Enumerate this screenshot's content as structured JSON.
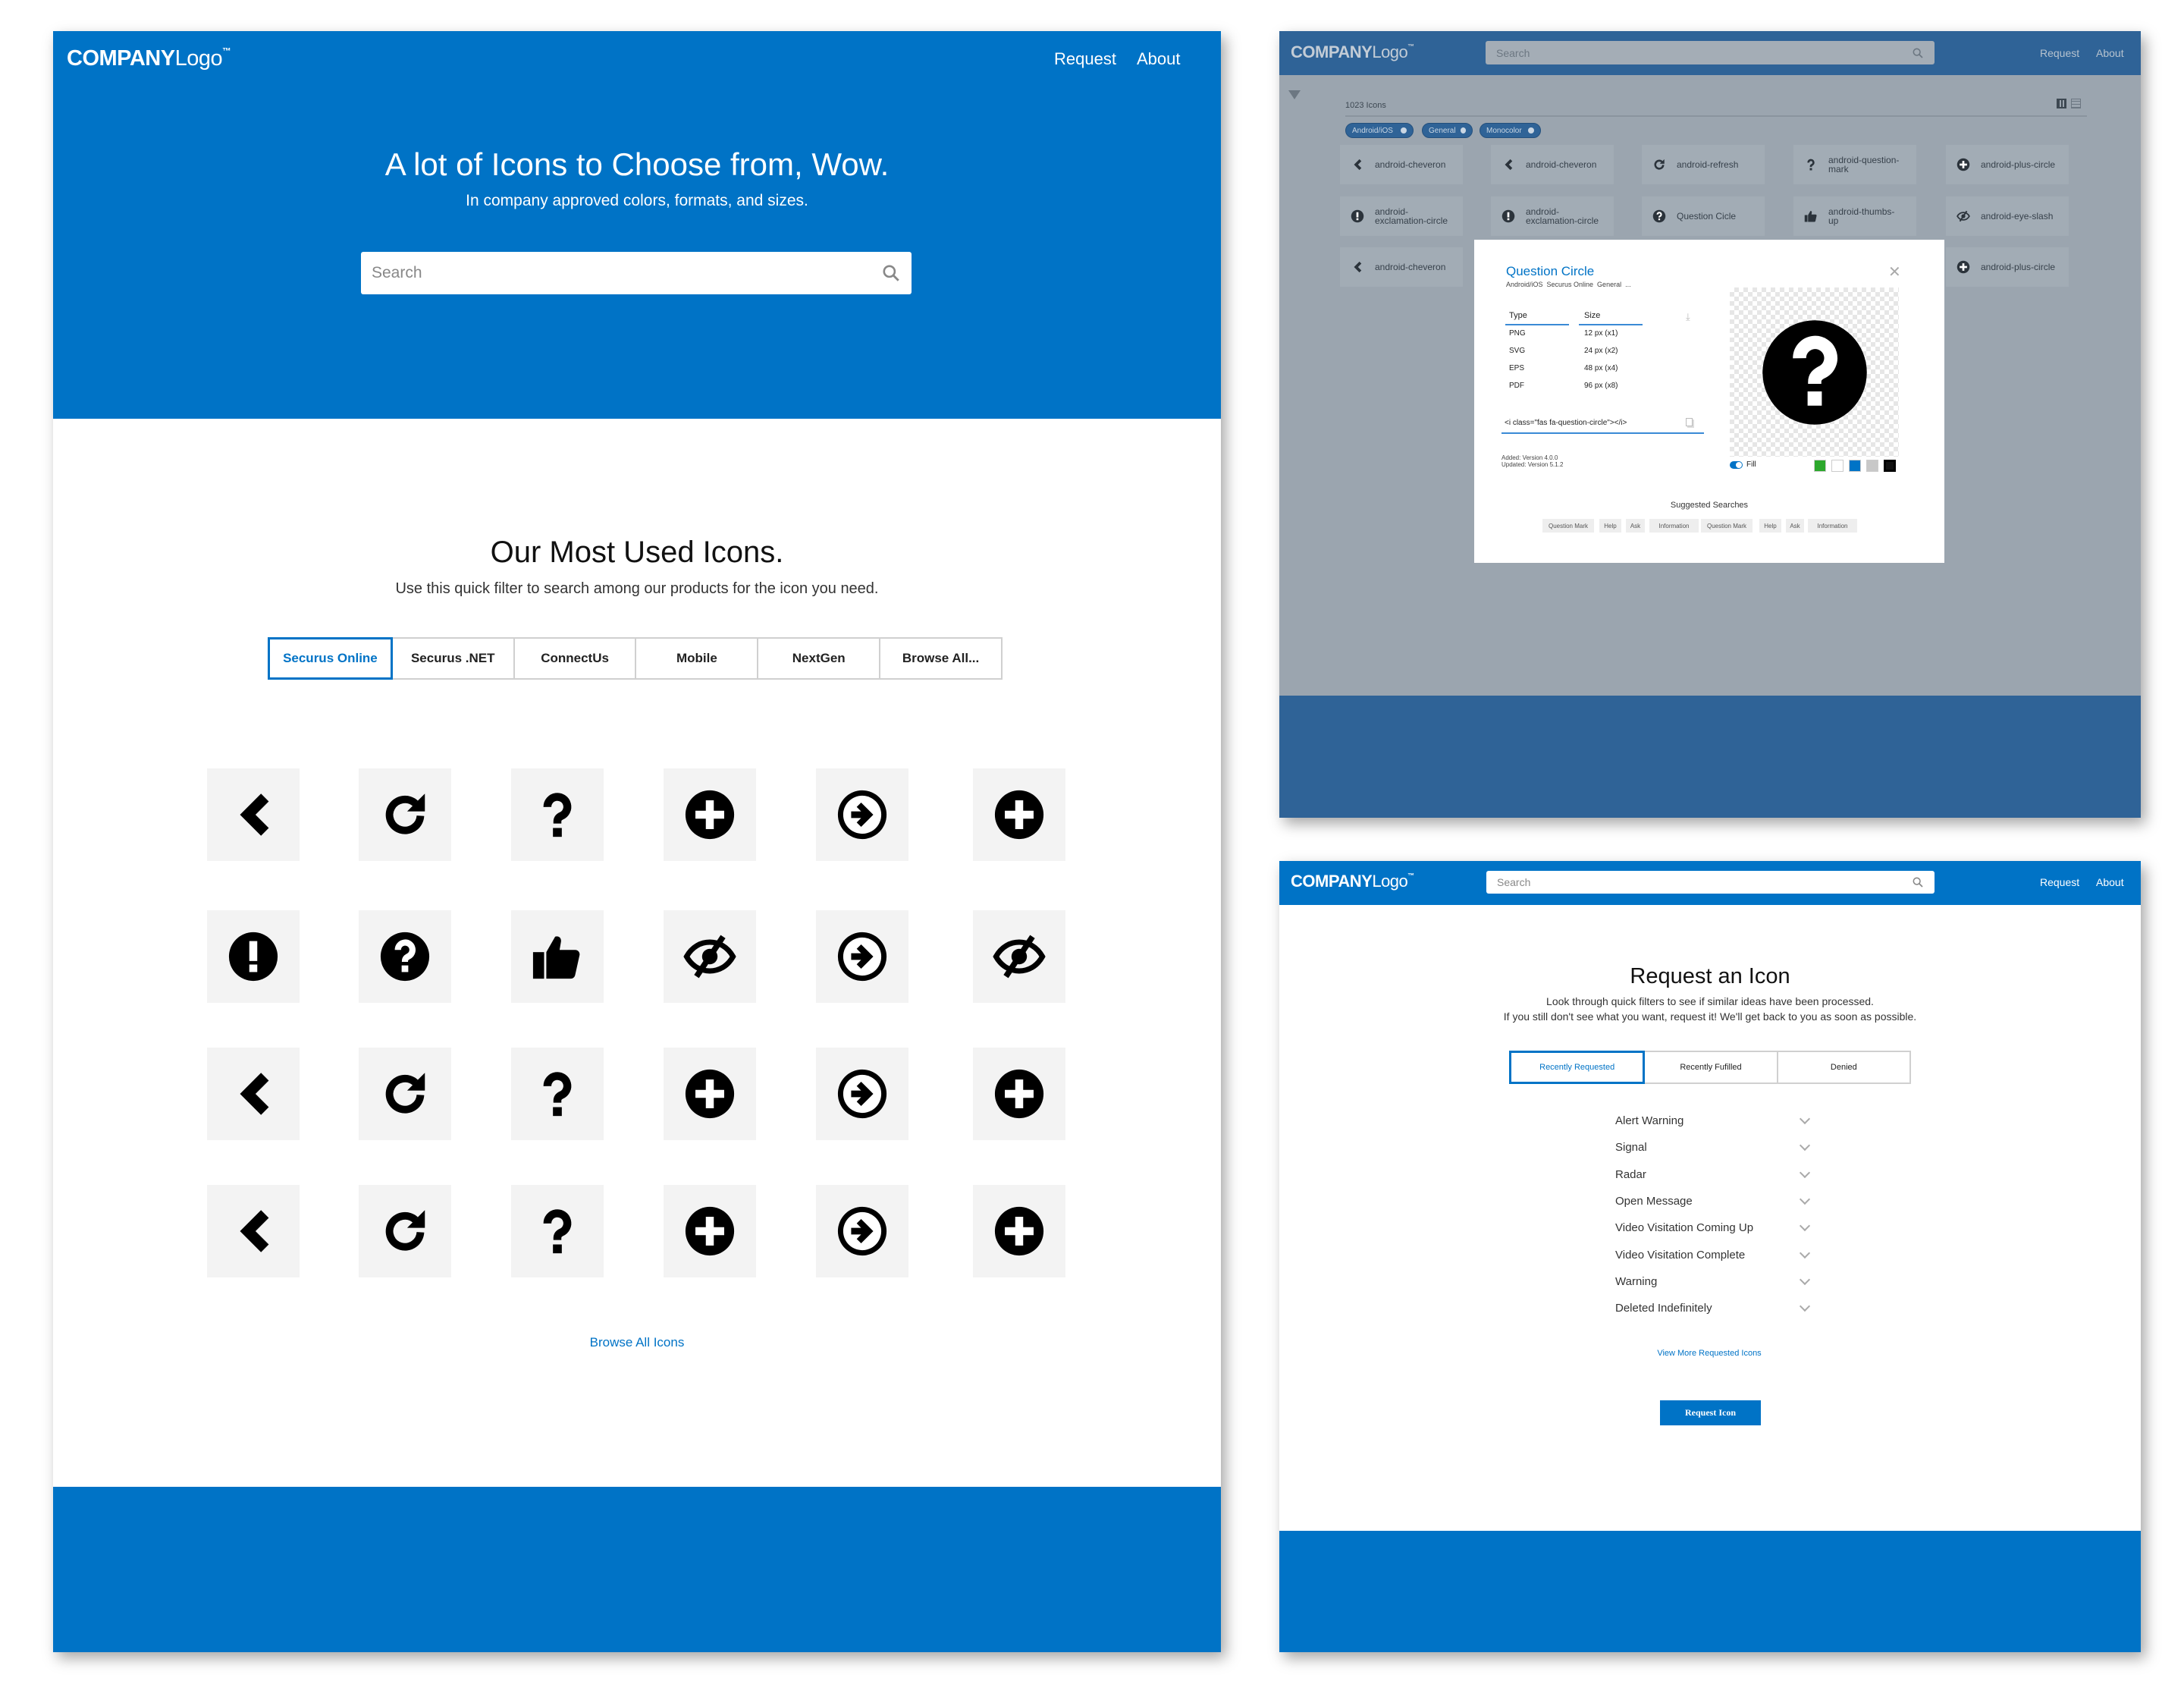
{
  "colors": {
    "brand_blue": "#0073c6",
    "overlay_gray": "#9ba5af"
  },
  "home": {
    "logo": {
      "bold": "COMPANY",
      "light": "Logo",
      "tm": "™"
    },
    "nav": {
      "request": "Request",
      "about": "About"
    },
    "hero_title": "A lot of Icons to Choose from, Wow.",
    "hero_subtitle": "In company approved colors, formats, and sizes.",
    "search_placeholder": "Search",
    "section_title": "Our Most Used Icons.",
    "section_subtitle": "Use this quick filter to search among our products for the icon you need.",
    "tabs": [
      {
        "label": "Securus Online",
        "active": true
      },
      {
        "label": "Securus .NET"
      },
      {
        "label": "ConnectUs"
      },
      {
        "label": "Mobile"
      },
      {
        "label": "NextGen"
      },
      {
        "label": "Browse All..."
      }
    ],
    "icon_grid": [
      [
        "chevron",
        "refresh",
        "question",
        "plus-circle",
        "arrow-circle-right",
        "plus-circle"
      ],
      [
        "exclamation-circle",
        "question-circle",
        "thumbs-up",
        "eye-slash",
        "arrow-circle-right",
        "eye-slash"
      ],
      [
        "chevron",
        "refresh",
        "question",
        "plus-circle",
        "arrow-circle-right",
        "plus-circle"
      ],
      [
        "chevron",
        "refresh",
        "question",
        "plus-circle",
        "arrow-circle-right",
        "plus-circle"
      ]
    ],
    "browse_all": "Browse All Icons"
  },
  "browse": {
    "logo": {
      "bold": "COMPANY",
      "light": "Logo",
      "tm": "™"
    },
    "search_placeholder": "Search",
    "nav": {
      "request": "Request",
      "about": "About"
    },
    "count": "1023 Icons",
    "chips": [
      "Android/iOS",
      "General",
      "Monocolor"
    ],
    "tiles": [
      [
        {
          "icon": "chevron",
          "label": "android-cheveron"
        },
        {
          "icon": "chevron",
          "label": "android-cheveron"
        },
        {
          "icon": "refresh",
          "label": "android-refresh"
        },
        {
          "icon": "question",
          "label": "android-question-mark"
        },
        {
          "icon": "plus-circle",
          "label": "android-plus-circle"
        }
      ],
      [
        {
          "icon": "exclamation-circle",
          "label": "android-exclamation-circle"
        },
        {
          "icon": "exclamation-circle",
          "label": "android-exclamation-circle"
        },
        {
          "icon": "question-circle",
          "label": "Question Cicle"
        },
        {
          "icon": "thumbs-up",
          "label": "android-thumbs-up"
        },
        {
          "icon": "eye-slash",
          "label": "android-eye-slash"
        }
      ],
      [
        {
          "icon": "chevron",
          "label": "android-cheveron"
        },
        null,
        null,
        null,
        {
          "icon": "plus-circle",
          "label": "android-plus-circle"
        }
      ]
    ],
    "modal": {
      "title": "Question Circle",
      "tags": "Android/iOS  Securus Online  General  ...",
      "type_header": "Type",
      "size_header": "Size",
      "rows": [
        {
          "type": "PNG",
          "size": "12 px (x1)"
        },
        {
          "type": "SVG",
          "size": "24 px (x2)"
        },
        {
          "type": "EPS",
          "size": "48 px (x4)"
        },
        {
          "type": "PDF",
          "size": "96 px (x8)"
        }
      ],
      "code": "<i class=\"fas fa-question-circle\"></i>",
      "added": "Added: Version 4.0.0",
      "updated": "Updated: Version 5.1.2",
      "fill_label": "Fill",
      "fill_on": true,
      "swatches": [
        "#2ca82c",
        "#ffffff",
        "#0073c6",
        "#c8c8c8",
        "#000000"
      ],
      "selected_swatch": "#000000",
      "suggested_title": "Suggested Searches",
      "suggested": [
        "Question Mark",
        "Help",
        "Ask",
        "Information",
        "Question Mark",
        "Help",
        "Ask",
        "Information"
      ]
    }
  },
  "request": {
    "logo": {
      "bold": "COMPANY",
      "light": "Logo",
      "tm": "™"
    },
    "search_placeholder": "Search",
    "nav": {
      "request": "Request",
      "about": "About"
    },
    "title": "Request an Icon",
    "subtitle1": "Look through quick filters to see if similar ideas have been processed.",
    "subtitle2": "If you still don't see what you want, request it! We'll get back to you as soon as possible.",
    "tabs": [
      {
        "label": "Recently Requested",
        "active": true
      },
      {
        "label": "Recently Fufilled"
      },
      {
        "label": "Denied"
      }
    ],
    "items": [
      "Alert Warning",
      "Signal",
      "Radar",
      "Open Message",
      "Video Visitation Coming Up",
      "Video Visitation Complete",
      "Warning",
      "Deleted Indefinitely"
    ],
    "view_more": "View More Requested Icons",
    "button": "Request Icon"
  }
}
